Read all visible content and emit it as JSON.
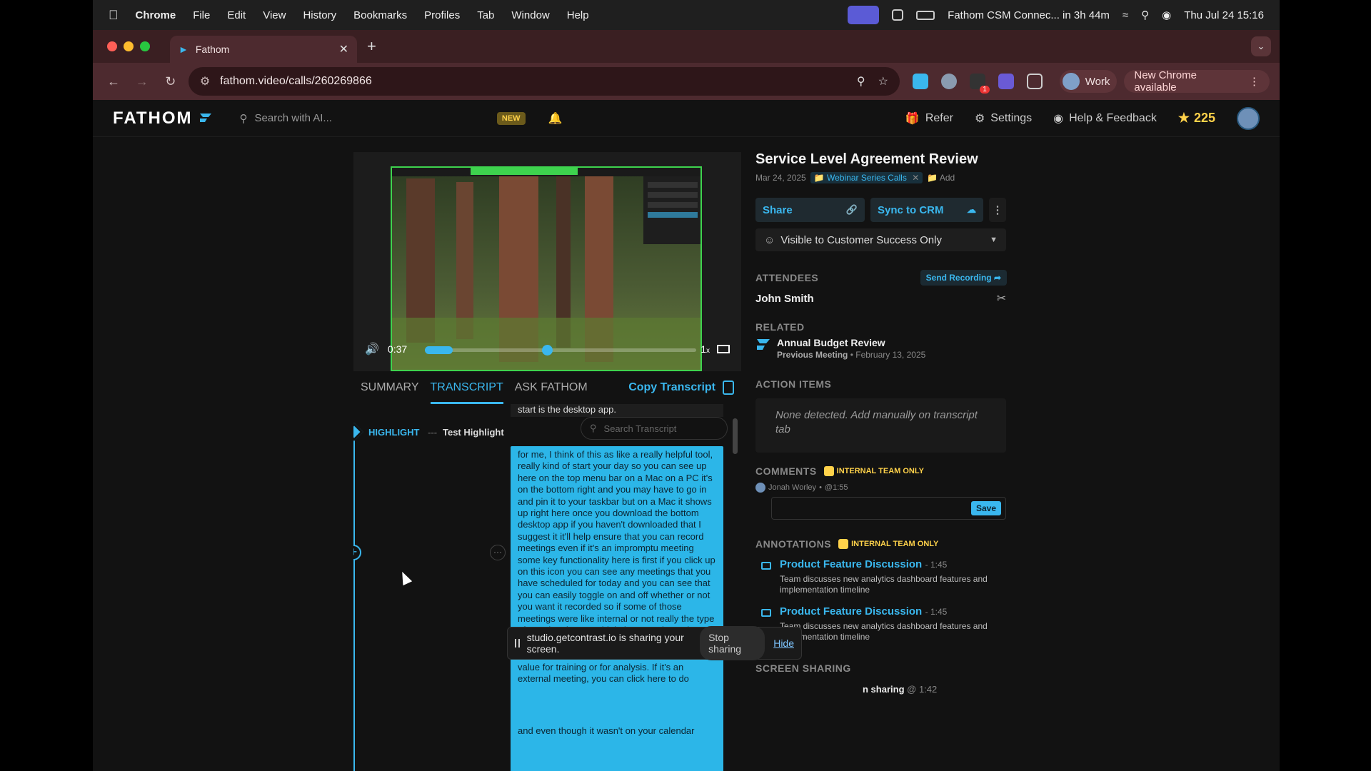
{
  "menubar": {
    "app": "Chrome",
    "items": [
      "File",
      "Edit",
      "View",
      "History",
      "Bookmarks",
      "Profiles",
      "Tab",
      "Window",
      "Help"
    ],
    "meeting_status": "Fathom CSM Connec... in 3h 44m",
    "datetime": "Thu Jul 24  15:16"
  },
  "browser": {
    "tab_title": "Fathom",
    "url": "fathom.video/calls/260269866",
    "extension_badge": "1",
    "profile": "Work",
    "update": "New Chrome available"
  },
  "app": {
    "logo": "FATHOM",
    "search_placeholder": "Search with AI...",
    "new_badge": "NEW",
    "nav": {
      "refer": "Refer",
      "settings": "Settings",
      "help": "Help & Feedback"
    },
    "points": "225",
    "accent": "#3ab7ee"
  },
  "player": {
    "time": "0:37",
    "speed": "1",
    "speed_suffix": "x",
    "progress": 0.05,
    "buffer": 0.45
  },
  "tabs": {
    "summary": "SUMMARY",
    "transcript": "TRANSCRIPT",
    "ask": "ASK FATHOM",
    "copy": "Copy Transcript"
  },
  "transcript": {
    "top_line": "start is the desktop app.",
    "search_placeholder": "Search Transcript",
    "highlight_label": "HIGHLIGHT",
    "highlight_sep": "---",
    "highlight_title": "Test Highlight",
    "more": "···",
    "block1": "for me, I think of this as like a really helpful tool, really kind of start your day so you can see up here on the top menu bar on a Mac on a PC it's on the bottom right and you may have to go in and pin it to your taskbar but on a Mac it shows up right here once you download the bottom desktop app if you haven't downloaded that I suggest it it'll help ensure that you can record meetings even if it's an impromptu meeting some key functionality here is first if you click up on this icon you can see any meetings that you have scheduled for today and you can see that you can easily toggle on and off whether or not you want it recorded so if some of those meetings were like internal or not really the type of meeting that you think there's going to be other learnings for the team then you can turn that off also if there's like an impromptu meeting that you think",
    "block2": "value for training or for analysis. If it's an external meeting, you can click here to do",
    "block2_tail": "and even though it wasn't on your calendar"
  },
  "meeting": {
    "title": "Service Level Agreement Review",
    "date": "Mar 24, 2025",
    "folder": "Webinar Series Calls",
    "folder_remove": "✕",
    "add": "Add",
    "share": "Share",
    "sync": "Sync to CRM",
    "visibility": "Visible to Customer Success Only"
  },
  "attendees": {
    "heading": "ATTENDEES",
    "send": "Send Recording",
    "names": [
      "John Smith"
    ]
  },
  "related": {
    "heading": "RELATED",
    "title": "Annual Budget Review",
    "kind": "Previous Meeting",
    "date": "February 13, 2025"
  },
  "action_items": {
    "heading": "ACTION ITEMS",
    "empty": "None detected. Add manually on transcript tab"
  },
  "comments": {
    "heading": "COMMENTS",
    "badge": "INTERNAL TEAM ONLY",
    "author": "Jonah Worley",
    "time": "@1:55",
    "save": "Save"
  },
  "annotations": {
    "heading": "ANNOTATIONS",
    "badge": "INTERNAL TEAM ONLY",
    "items": [
      {
        "title": "Product Feature Discussion",
        "time": "- 1:45",
        "desc": "Team discusses new analytics dashboard features and implementation timeline"
      },
      {
        "title": "Product Feature Discussion",
        "time": "- 1:45",
        "desc": "Team discusses new analytics dashboard features and implementation timeline"
      }
    ]
  },
  "screen_sharing": {
    "heading": "SCREEN SHARING",
    "entry": "n sharing",
    "time": "@ 1:42"
  },
  "share_banner": {
    "text": "studio.getcontrast.io is sharing your screen.",
    "stop": "Stop sharing",
    "hide": "Hide"
  }
}
